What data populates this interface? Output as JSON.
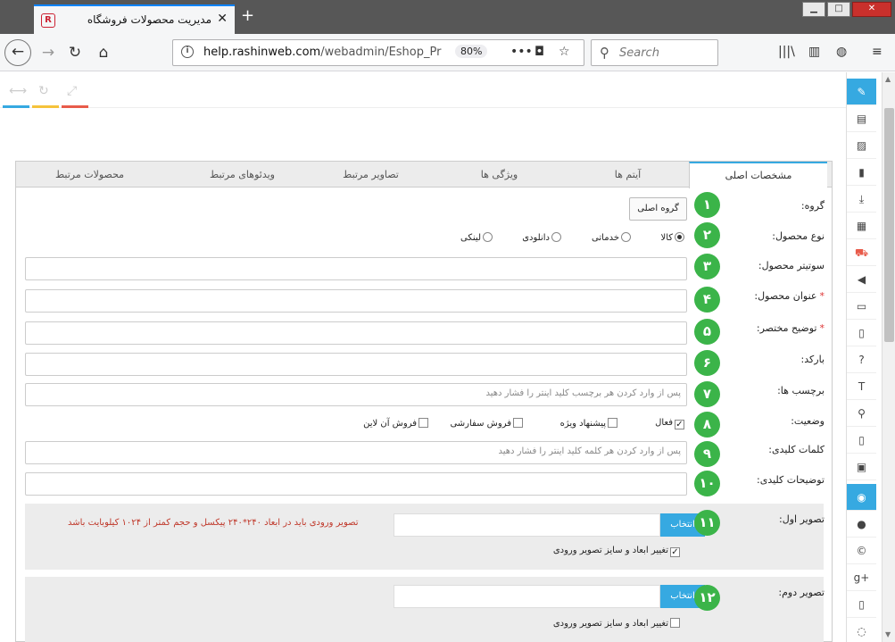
{
  "browser": {
    "tab_title": "مدیریت محصولات فروشگاه",
    "url_host": "help.rashinweb.com",
    "url_path": "/webadmin/Eshop_Pr",
    "zoom": "80%",
    "search_placeholder": "Search"
  },
  "tabs": [
    {
      "label": "مشخصات اصلی",
      "active": true
    },
    {
      "label": "آیتم ها"
    },
    {
      "label": "ویژگی ها"
    },
    {
      "label": "تصاویر مرتبط"
    },
    {
      "label": "ویدئوهای مرتبط"
    },
    {
      "label": "محصولات مرتبط"
    }
  ],
  "form": {
    "group": {
      "label": "گروه:",
      "button": "گروه اصلی",
      "num": "۱"
    },
    "type": {
      "label": "نوع محصول:",
      "num": "۲",
      "options": [
        "کالا",
        "خدماتی",
        "دانلودی",
        "لینکی"
      ],
      "selected": "کالا"
    },
    "subtitle": {
      "label": "سوتیتر محصول:",
      "num": "۳",
      "value": ""
    },
    "title": {
      "label": "عنوان محصول:",
      "num": "۴",
      "value": ""
    },
    "short_desc": {
      "label": "توضیح مختصر:",
      "num": "۵",
      "value": ""
    },
    "barcode": {
      "label": "بارکد:",
      "num": "۶",
      "value": ""
    },
    "tags": {
      "label": "برچسب ها:",
      "num": "۷",
      "placeholder": "پس از وارد کردن هر برچسب کلید اینتر را فشار دهید"
    },
    "status": {
      "label": "وضعیت:",
      "num": "۸",
      "options": [
        {
          "text": "فعال",
          "checked": true
        },
        {
          "text": "پیشنهاد ویژه",
          "checked": false
        },
        {
          "text": "فروش سفارشی",
          "checked": false
        },
        {
          "text": "فروش آن لاین",
          "checked": false
        }
      ]
    },
    "keywords": {
      "label": "کلمات کلیدی:",
      "num": "۹",
      "placeholder": "پس از وارد کردن هر کلمه کلید اینتر را فشار دهید"
    },
    "key_desc": {
      "label": "توضیحات کلیدی:",
      "num": "۱۰",
      "value": ""
    },
    "image1": {
      "label": "تصویر اول:",
      "num": "۱۱",
      "button": "انتخاب",
      "resize_label": "تغییر ابعاد و سایز تصویر ورودی",
      "resize_checked": true,
      "note": "تصویر ورودی باید در ابعاد ۲۴۰*۲۴۰ پیکسل و حجم کمتر از ۱۰۲۴ کیلوبایت باشد"
    },
    "image2": {
      "label": "تصویر دوم:",
      "num": "۱۲",
      "button": "انتخاب",
      "resize_label": "تغییر ابعاد و سایز تصویر ورودی",
      "resize_checked": false
    }
  },
  "colors": {
    "accent": "#36a9e1",
    "number_badge": "#3bb449",
    "note": "#c0392b"
  }
}
